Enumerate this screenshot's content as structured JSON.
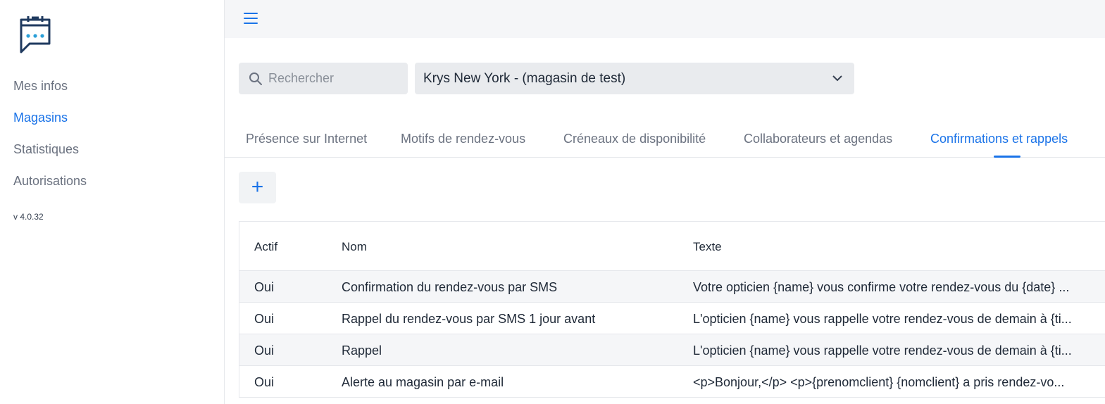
{
  "sidebar": {
    "items": [
      {
        "label": "Mes infos",
        "active": false
      },
      {
        "label": "Magasins",
        "active": true
      },
      {
        "label": "Statistiques",
        "active": false
      },
      {
        "label": "Autorisations",
        "active": false
      }
    ],
    "version": "v 4.0.32"
  },
  "search": {
    "placeholder": "Rechercher",
    "value": ""
  },
  "store_select": {
    "selected": "Krys New York - (magasin de test)"
  },
  "tabs": [
    {
      "label": "Présence sur Internet"
    },
    {
      "label": "Motifs de rendez-vous"
    },
    {
      "label": "Créneaux de disponibilité"
    },
    {
      "label": "Collaborateurs et agendas"
    },
    {
      "label": "Confirmations et rappels",
      "active": true
    }
  ],
  "add_button": {
    "label": "+"
  },
  "table": {
    "headers": [
      "Actif",
      "Nom",
      "Texte"
    ],
    "rows": [
      {
        "actif": "Oui",
        "nom": "Confirmation du rendez-vous par SMS",
        "texte": "Votre opticien {name} vous confirme votre rendez-vous du {date} ..."
      },
      {
        "actif": "Oui",
        "nom": "Rappel du rendez-vous par SMS 1 jour avant",
        "texte": "L'opticien {name} vous rappelle votre rendez-vous de demain à {ti..."
      },
      {
        "actif": "Oui",
        "nom": "Rappel",
        "texte": "L'opticien {name} vous rappelle votre rendez-vous de demain à {ti..."
      },
      {
        "actif": "Oui",
        "nom": "Alerte au magasin par e-mail",
        "texte": "<p>Bonjour,</p> <p>{prenomclient} {nomclient} a pris rendez-vo..."
      }
    ]
  },
  "colors": {
    "accent": "#1a73e8",
    "logo_dark": "#1f3a5f",
    "logo_dots": "#2a9fd8"
  }
}
